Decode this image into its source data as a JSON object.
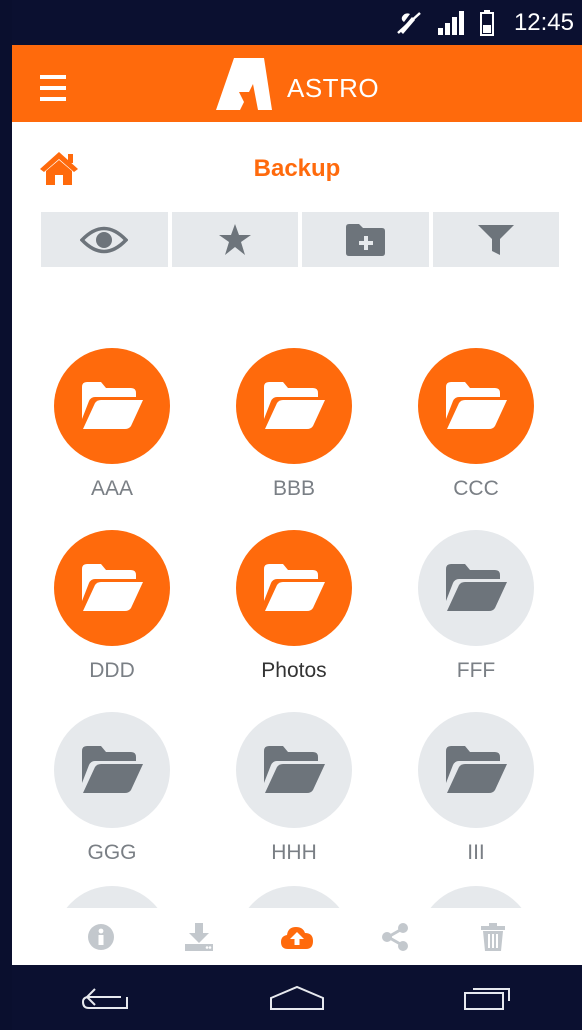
{
  "status": {
    "time": "12:45"
  },
  "appbar": {
    "title": "ASTRO"
  },
  "breadcrumb": {
    "title": "Backup"
  },
  "toolbar": {
    "items": [
      {
        "icon": "eye-icon"
      },
      {
        "icon": "star-icon"
      },
      {
        "icon": "new-folder-icon"
      },
      {
        "icon": "filter-icon"
      }
    ]
  },
  "folders": [
    {
      "name": "AAA",
      "state": "selected"
    },
    {
      "name": "BBB",
      "state": "selected"
    },
    {
      "name": "CCC",
      "state": "selected"
    },
    {
      "name": "DDD",
      "state": "selected"
    },
    {
      "name": "Photos",
      "state": "selected"
    },
    {
      "name": "FFF",
      "state": "unselected"
    },
    {
      "name": "GGG",
      "state": "unselected"
    },
    {
      "name": "HHH",
      "state": "unselected"
    },
    {
      "name": "III",
      "state": "unselected"
    }
  ],
  "bottom_actions": [
    {
      "icon": "info-icon"
    },
    {
      "icon": "download-icon"
    },
    {
      "icon": "cloud-upload-icon"
    },
    {
      "icon": "share-icon"
    },
    {
      "icon": "trash-icon"
    }
  ],
  "colors": {
    "accent": "#ff6a0c",
    "tile_grey": "#e6e9ec",
    "icon_grey": "#6d747b",
    "status_bg": "#0b1030"
  }
}
